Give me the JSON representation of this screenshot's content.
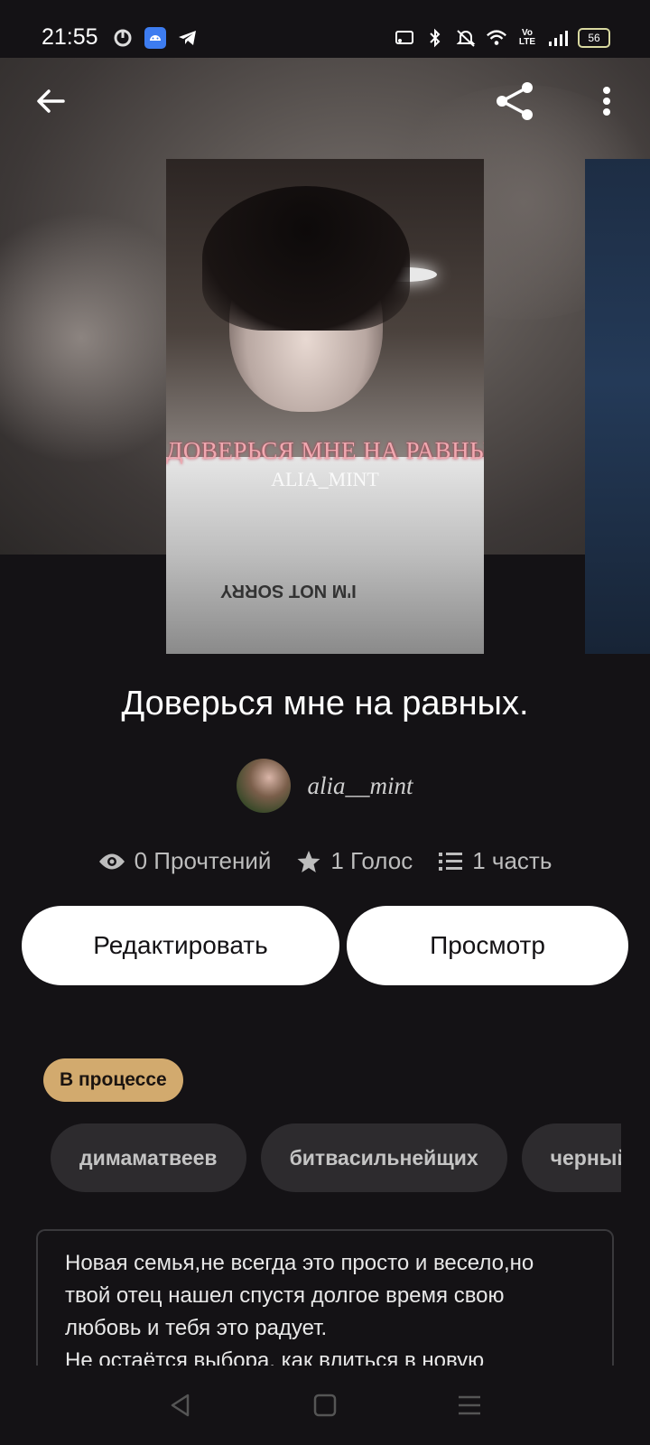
{
  "status_bar": {
    "time": "21:55",
    "battery": "56",
    "icons": [
      "timer-icon",
      "android-icon",
      "telegram-icon",
      "cast-icon",
      "bluetooth-icon",
      "mute-icon",
      "wifi-icon",
      "volte-icon",
      "signal-icon",
      "battery-icon"
    ]
  },
  "toolbar": {
    "back_icon": "arrow-left-icon",
    "share_icon": "share-icon",
    "more_icon": "more-vertical-icon"
  },
  "cover": {
    "title_text": "ДОВЕРЬСЯ МНЕ НА РАВНЫХ",
    "author_text": "ALIA_MINT",
    "shirt_text": "I'M NOT SORRY"
  },
  "book": {
    "title": "Доверься мне на равных.",
    "author": "alia__mint"
  },
  "stats": {
    "reads": "0 Прочтений",
    "votes": "1 Голос",
    "parts": "1 часть"
  },
  "actions": {
    "edit_label": "Редактировать",
    "view_label": "Просмотр"
  },
  "status_badge": "В процессе",
  "tags": [
    "димаматвеев",
    "битвасильнейщих",
    "черный"
  ],
  "description": {
    "line1": "Новая семья,не всегда это просто и весело,но",
    "line2": "твой отец нашел спустя долгое время свою",
    "line3": "любовь и тебя это радует.",
    "line4": "Не остаётся выбора, как влиться в новую"
  },
  "nav": {
    "back_icon": "triangle-back-icon",
    "home_icon": "square-home-icon",
    "menu_icon": "menu-lines-icon"
  },
  "colors": {
    "background": "#141215",
    "badge": "#d2aa6e",
    "tag_bg": "#2d2b2e"
  }
}
